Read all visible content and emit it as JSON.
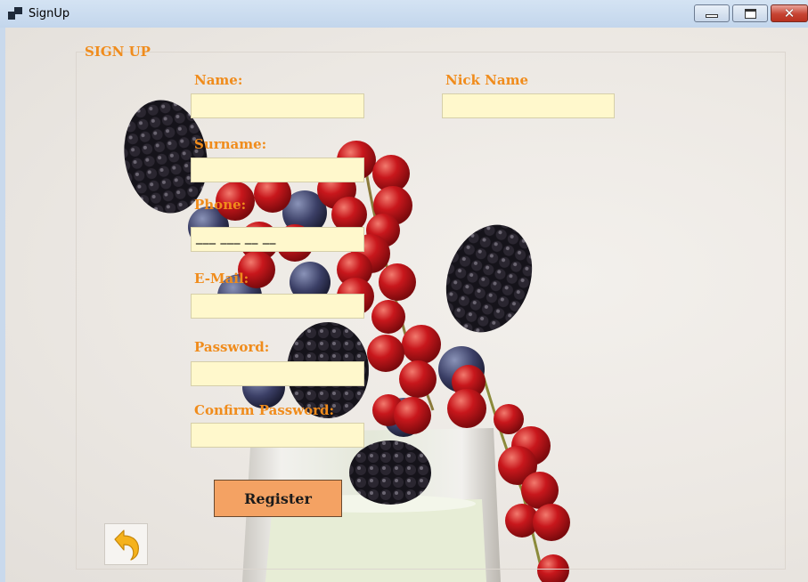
{
  "window": {
    "title": "SignUp",
    "close_glyph": "✕"
  },
  "form": {
    "heading": "SIGN UP",
    "name_label": "Name:",
    "nickname_label": "Nick Name",
    "surname_label": "Surname:",
    "phone_label": "Phone:",
    "phone_mask": "___ ___ __ __",
    "email_label": "E-Mail:",
    "password_label": "Password:",
    "confirm_password_label": "Confirm Password:",
    "name_value": "",
    "nickname_value": "",
    "surname_value": "",
    "email_value": "",
    "password_value": "",
    "confirm_password_value": "",
    "register_label": "Register",
    "back_icon": "undo-arrow-icon"
  },
  "colors": {
    "label_orange": "#f08c1c",
    "field_bg": "#fff8cc",
    "button_bg": "#f4a263"
  }
}
